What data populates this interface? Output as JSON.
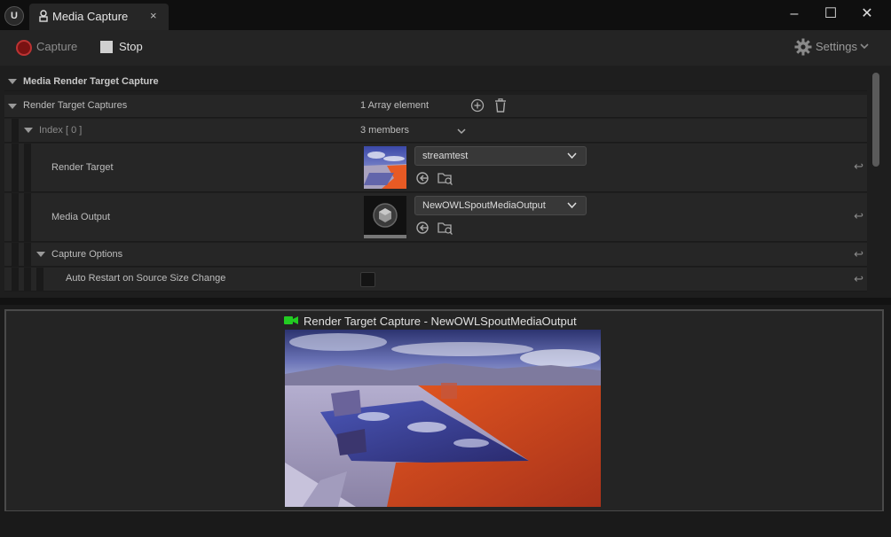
{
  "window": {
    "tab_title": "Media Capture",
    "tab_close": "×",
    "minimize": "–",
    "maximize": "☐",
    "close": "✕"
  },
  "toolbar": {
    "capture_label": "Capture",
    "stop_label": "Stop",
    "settings_label": "Settings"
  },
  "details": {
    "section_title": "Media Render Target Capture",
    "render_target_captures": {
      "label": "Render Target Captures",
      "value": "1 Array element"
    },
    "index": {
      "label_prefix": "Index [ ",
      "index": "0",
      "label_suffix": " ]",
      "value": "3 members"
    },
    "render_target": {
      "label": "Render Target",
      "asset": "streamtest"
    },
    "media_output": {
      "label": "Media Output",
      "asset": "NewOWLSpoutMediaOutput"
    },
    "capture_options": {
      "label": "Capture Options"
    },
    "auto_restart": {
      "label": "Auto Restart on Source Size Change",
      "checked": false
    }
  },
  "preview": {
    "title": "Render Target Capture - NewOWLSpoutMediaOutput"
  },
  "colors": {
    "capture_indicator": "#7a1212",
    "camera_icon": "#22cc22",
    "accent_orange": "#e3501c"
  }
}
